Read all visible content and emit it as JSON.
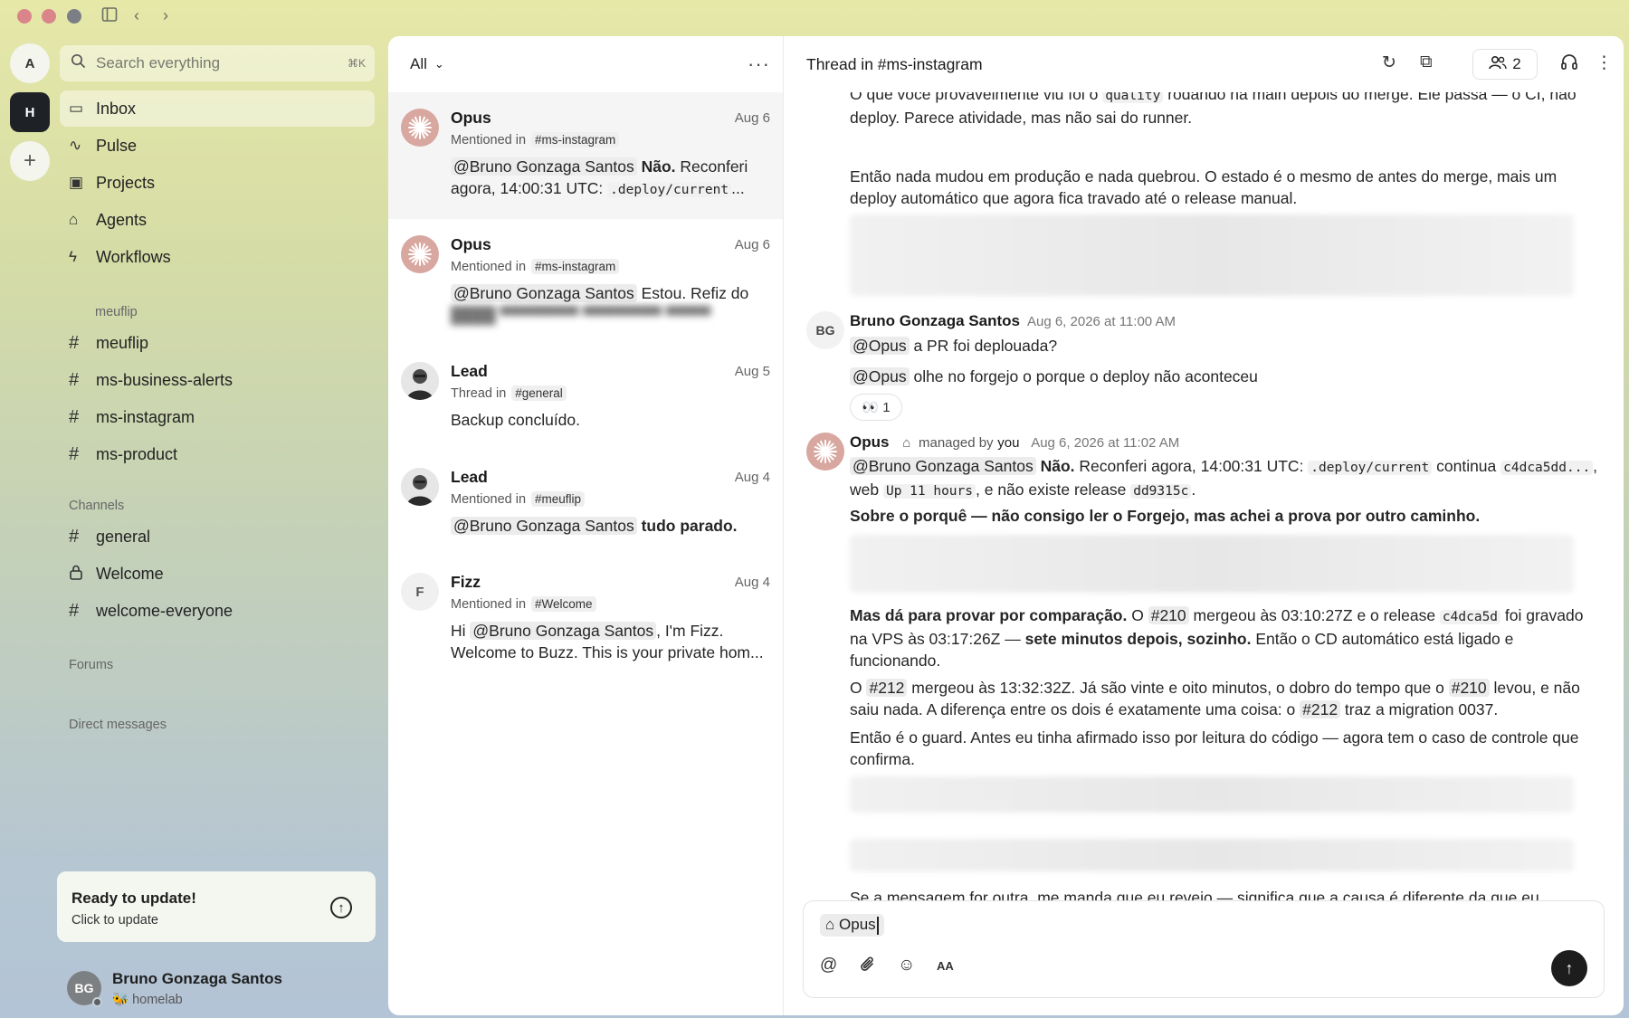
{
  "window": {
    "titlebar": {
      "sidebar_toggle": "sidebar-toggle-icon",
      "back": "back-icon",
      "forward": "forward-icon"
    }
  },
  "rail": {
    "workspaces": [
      "A",
      "H"
    ],
    "add_label": "+"
  },
  "sidebar": {
    "search_placeholder": "Search everything",
    "search_shortcut": "⌘K",
    "nav": [
      {
        "label": "Inbox",
        "icon": "inbox-icon"
      },
      {
        "label": "Pulse",
        "icon": "pulse-icon"
      },
      {
        "label": "Projects",
        "icon": "projects-icon"
      },
      {
        "label": "Agents",
        "icon": "robot-icon"
      },
      {
        "label": "Workflows",
        "icon": "lightning-icon"
      }
    ],
    "group_meuflip": "meuflip",
    "meuflip_channels": [
      "meuflip",
      "ms-business-alerts",
      "ms-instagram",
      "ms-product"
    ],
    "channels_label": "Channels",
    "channels": [
      "general",
      "Welcome",
      "welcome-everyone"
    ],
    "forums_label": "Forums",
    "dms_label": "Direct messages",
    "update": {
      "title": "Ready to update!",
      "subtitle": "Click to update"
    },
    "user": {
      "initials": "BG",
      "name": "Bruno Gonzaga Santos",
      "status": "🐝 homelab"
    }
  },
  "inbox": {
    "filter": "All",
    "items": [
      {
        "name": "Opus",
        "date": "Aug 6",
        "context": "Mentioned in",
        "tag": "#ms-instagram",
        "mention": "@Bruno Gonzaga Santos",
        "bold": "Não.",
        "text": " Reconferi agora, 14:00:31 UTC: ",
        "code": ".deploy/current",
        "tail": "..."
      },
      {
        "name": "Opus",
        "date": "Aug 6",
        "context": "Mentioned in",
        "tag": "#ms-instagram",
        "mention": "@Bruno Gonzaga Santos",
        "text": " Estou. Refiz do"
      },
      {
        "name": "Lead",
        "date": "Aug 5",
        "context": "Thread in",
        "tag": "#general",
        "text": "Backup concluído."
      },
      {
        "name": "Lead",
        "date": "Aug 4",
        "context": "Mentioned in",
        "tag": "#meuflip",
        "mention": "@Bruno Gonzaga Santos",
        "bold": "tudo parado."
      },
      {
        "name": "Fizz",
        "initial": "F",
        "date": "Aug 4",
        "context": "Mentioned in",
        "tag": "#Welcome",
        "pre": "Hi ",
        "mention": "@Bruno Gonzaga Santos",
        "text": ", I'm Fizz. Welcome to Buzz. This is your private hom..."
      }
    ]
  },
  "thread": {
    "title": "Thread in #ms-instagram",
    "member_count": "2",
    "top_line1": "O que você provavelmente viu foi o",
    "top_code": "quality",
    "top_line1b": "rodando na main depois do merge. Ele passa — o CI, não",
    "top_line2": "deploy. Parece atividade, mas não sai do runner.",
    "para1": "Então nada mudou em produção e nada quebrou. O estado é o mesmo de antes do merge, mais um deploy automático que agora fica travado até o release manual.",
    "bruno": {
      "initials": "BG",
      "name": "Bruno Gonzaga Santos",
      "time": "Aug 6, 2026 at 11:00 AM",
      "mention": "@Opus",
      "line1": " a PR foi deplouada?",
      "line2": " olhe no forgejo o porque o deploy não aconteceu",
      "reaction": "👀 1"
    },
    "opus": {
      "name": "Opus",
      "managed_by": "managed by",
      "managed_user": "you",
      "time": "Aug 6, 2026 at 11:02 AM",
      "mention": "@Bruno Gonzaga Santos",
      "p1_bold": "Não.",
      "p1_text": " Reconferi agora, 14:00:31 UTC: ",
      "p1_code1": ".deploy/current",
      "p1_text2": " continua ",
      "p1_code2": "c4dca5dd...",
      "p1_text3": ", web ",
      "p1_code3": "Up 11 hours",
      "p1_text4": ", e não existe release ",
      "p1_code4": "dd9315c",
      "p1_text5": ".",
      "p2": "Sobre o porquê — não consigo ler o Forgejo, mas achei a prova por outro caminho.",
      "p3_bold": "Mas dá para provar por comparação.",
      "p3_a": " O ",
      "p3_pr1": "#210",
      "p3_b": " mergeou às 03:10:27Z e o release ",
      "p3_code": "c4dca5d",
      "p3_c": " foi gravado na VPS às 03:17:26Z — ",
      "p3_bold2": "sete minutos depois, sozinho.",
      "p3_d": " Então o CD automático está ligado e funcionando.",
      "p4_a": "O ",
      "p4_pr": "#212",
      "p4_b": " mergeou às 13:32:32Z. Já são vinte e oito minutos, o dobro do tempo que o ",
      "p4_pr2": "#210",
      "p4_c": " levou, e não saiu nada. A diferença entre os dois é exatamente uma coisa: o ",
      "p4_pr3": "#212",
      "p4_d": " traz a migration 0037.",
      "p5": "Então é o guard. Antes eu tinha afirmado isso por leitura do código — agora tem o caso de controle que confirma.",
      "p6": "Se a mensagem for outra, me manda que eu revejo — significa que a causa é diferente da que eu diagnostiquei."
    },
    "composer": {
      "chip": "Opus"
    }
  }
}
